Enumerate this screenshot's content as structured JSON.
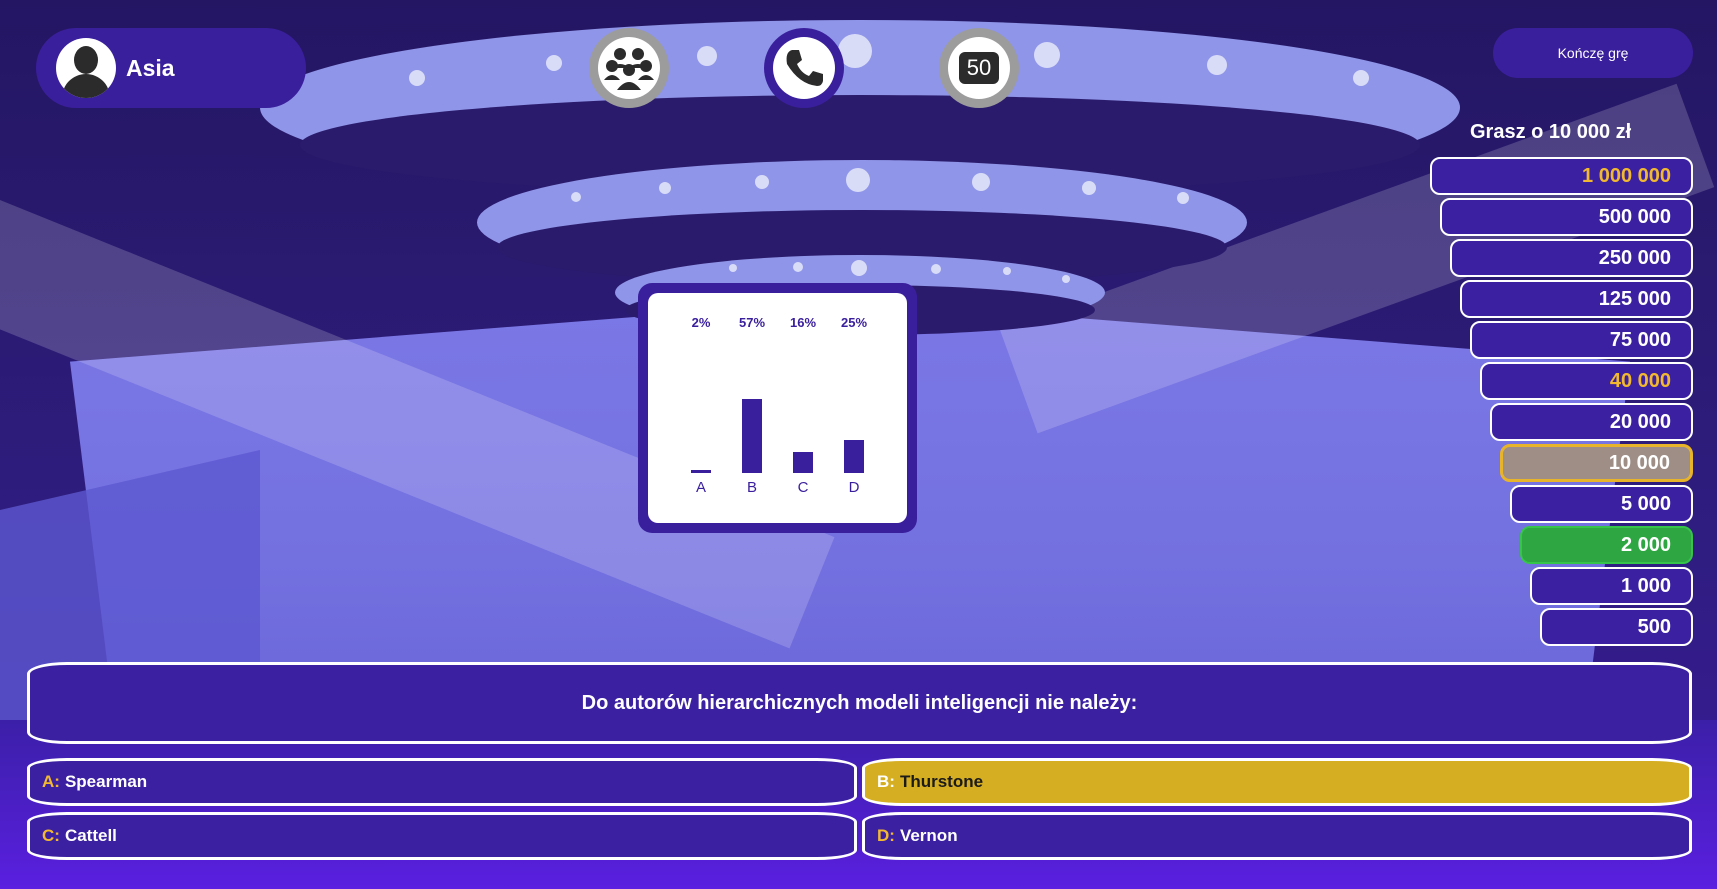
{
  "player": {
    "name": "Asia",
    "avatar_icon": "user-silhouette-icon"
  },
  "lifelines": [
    {
      "name": "ask-the-audience",
      "icon": "audience-icon",
      "state": "used"
    },
    {
      "name": "phone-a-friend",
      "icon": "phone-icon",
      "state": "available"
    },
    {
      "name": "fifty-fifty",
      "label": "50",
      "icon": "fifty-fifty-icon",
      "state": "used"
    }
  ],
  "quit_label": "Kończę grę",
  "play_for_label": "Grasz o 10 000 zł",
  "ladder": [
    {
      "amount": "1 000 000",
      "state": "milestone"
    },
    {
      "amount": "500 000",
      "state": "normal"
    },
    {
      "amount": "250 000",
      "state": "normal"
    },
    {
      "amount": "125 000",
      "state": "normal"
    },
    {
      "amount": "75 000",
      "state": "normal"
    },
    {
      "amount": "40 000",
      "state": "milestone"
    },
    {
      "amount": "20 000",
      "state": "normal"
    },
    {
      "amount": "10 000",
      "state": "current"
    },
    {
      "amount": "5 000",
      "state": "normal"
    },
    {
      "amount": "2 000",
      "state": "won"
    },
    {
      "amount": "1 000",
      "state": "normal"
    },
    {
      "amount": "500",
      "state": "normal"
    }
  ],
  "poll": [
    {
      "letter": "A",
      "percent_label": "2%",
      "value": 2
    },
    {
      "letter": "B",
      "percent_label": "57%",
      "value": 57
    },
    {
      "letter": "C",
      "percent_label": "16%",
      "value": 16
    },
    {
      "letter": "D",
      "percent_label": "25%",
      "value": 25
    }
  ],
  "question": "Do autorów hierarchicznych modeli inteligencji nie należy:",
  "answers": [
    {
      "letter": "A:",
      "text": "Spearman",
      "selected": false
    },
    {
      "letter": "B:",
      "text": "Thurstone",
      "selected": true
    },
    {
      "letter": "C:",
      "text": "Cattell",
      "selected": false
    },
    {
      "letter": "D:",
      "text": "Vernon",
      "selected": false
    }
  ],
  "colors": {
    "panel": "#3b21a2",
    "accent": "#f2b82f",
    "selected": "#d6ae21",
    "won": "#2ea641"
  }
}
